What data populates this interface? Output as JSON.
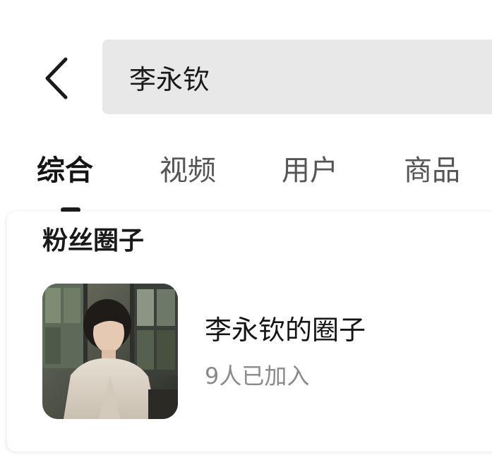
{
  "search": {
    "query": "李永钦"
  },
  "tabs": [
    {
      "label": "综合",
      "active": true
    },
    {
      "label": "视频",
      "active": false
    },
    {
      "label": "用户",
      "active": false
    },
    {
      "label": "商品",
      "active": false
    }
  ],
  "fan_circles": {
    "section_title": "粉丝圈子",
    "items": [
      {
        "name": "李永钦的圈子",
        "members": "9人已加入"
      }
    ]
  },
  "icons": {
    "back": "chevron-left-icon"
  },
  "colors": {
    "search_bg": "#e8e8e8",
    "active_tab": "#151515",
    "inactive_tab": "#555555",
    "meta_text": "#8a8a8a"
  }
}
